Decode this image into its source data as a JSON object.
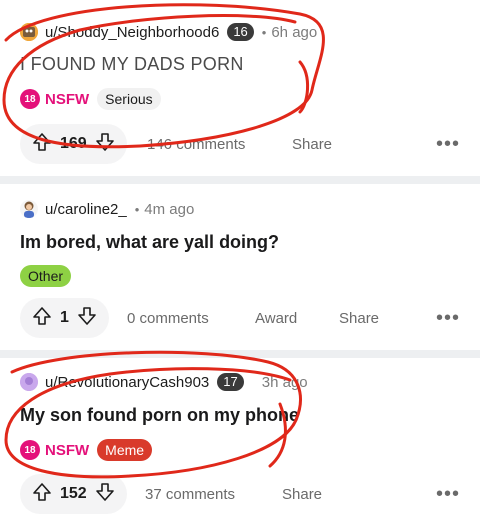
{
  "posts": [
    {
      "username": "u/Shoddy_Neighborhood6",
      "karma_badge": "16",
      "separator": "•",
      "time": "6h ago",
      "title": "I FOUND MY DADS PORN",
      "nsfw_icon_text": "18",
      "nsfw_label": "NSFW",
      "flair": "Serious",
      "votes": "169",
      "comments": "146 comments",
      "share": "Share",
      "more": "•••"
    },
    {
      "username": "u/caroline2_",
      "separator": "•",
      "time": "4m ago",
      "title": "Im bored, what are yall doing?",
      "flair": "Other",
      "votes": "1",
      "comments": "0 comments",
      "award": "Award",
      "share": "Share",
      "more": "•••"
    },
    {
      "username": "u/RevolutionaryCash903",
      "karma_badge": "17",
      "time": "3h ago",
      "title": "My son found porn on my phone",
      "nsfw_icon_text": "18",
      "nsfw_label": "NSFW",
      "flair": "Meme",
      "votes": "152",
      "comments": "37 comments",
      "share": "Share",
      "more": "•••"
    }
  ],
  "icons": {
    "upvote": "arrow-up-outline-icon",
    "downvote": "arrow-down-outline-icon",
    "nsfw": "nsfw-18-icon",
    "more": "more-horizontal-icon"
  },
  "colors": {
    "nsfw": "#e4117a",
    "flair_serious": "#f1f1f1",
    "flair_other": "#8ed144",
    "flair_meme": "#d93a2b",
    "karma_badge": "#3a3a3a",
    "annotation_red": "#e0281a"
  }
}
